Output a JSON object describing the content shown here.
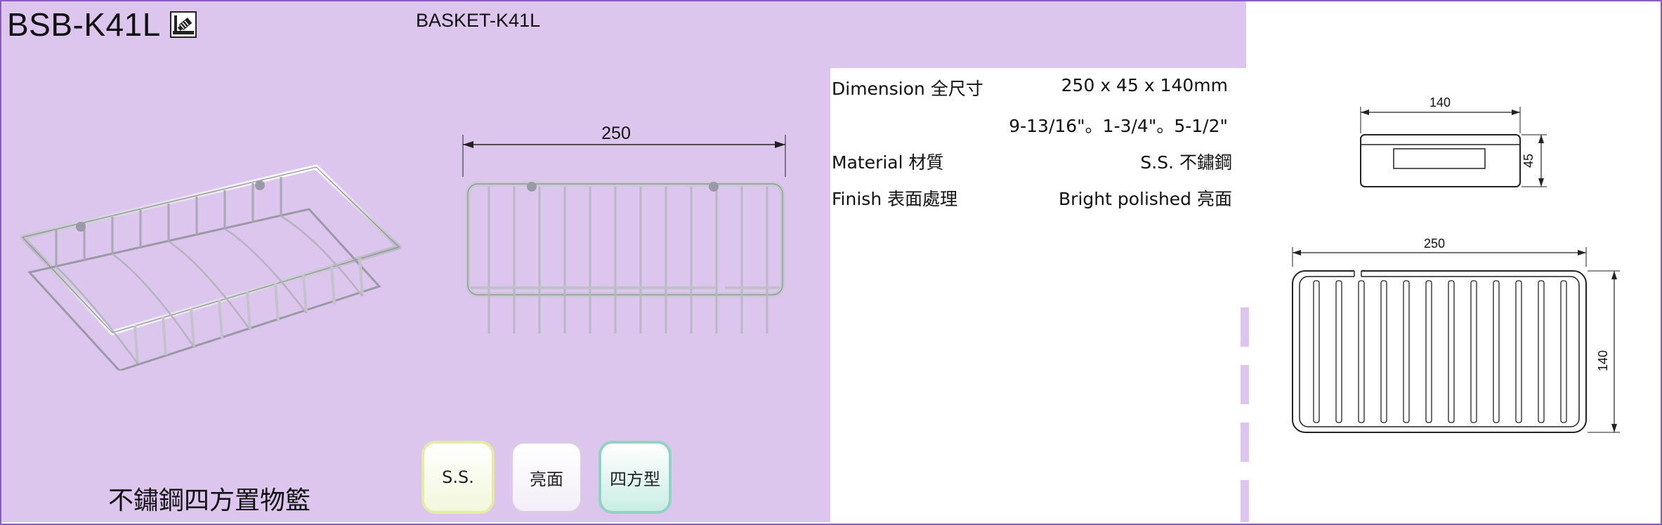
{
  "product": {
    "code": "BSB-K41L",
    "model_name": "BASKET-K41L",
    "chinese_name": "不鏽鋼四方置物籃"
  },
  "badges": [
    {
      "label": "S.S."
    },
    {
      "label": "亮面"
    },
    {
      "label": "四方型"
    }
  ],
  "specs": {
    "dimension_label": "Dimension 全尺寸",
    "dimension_value": "250 x 45 x 140mm",
    "dimension_inch": "9-13/16\"。1-3/4\"。5-1/2\"",
    "material_label": "Material 材質",
    "material_value": "S.S. 不鏽鋼",
    "finish_label": "Finish 表面處理",
    "finish_value": "Bright polished 亮面"
  },
  "drawing": {
    "front_width": "250",
    "side_width": "140",
    "side_height": "45",
    "top_width": "250",
    "top_depth": "140"
  },
  "colors": {
    "background_lilac": "#dcc6ee",
    "frame_purple": "#8a5cc0",
    "badge_ss": "#e3eda2",
    "badge_finish": "#d9cbe8",
    "badge_shape": "#8fd3c2"
  },
  "icons": {
    "install_symbol": "screw-mount-icon"
  }
}
